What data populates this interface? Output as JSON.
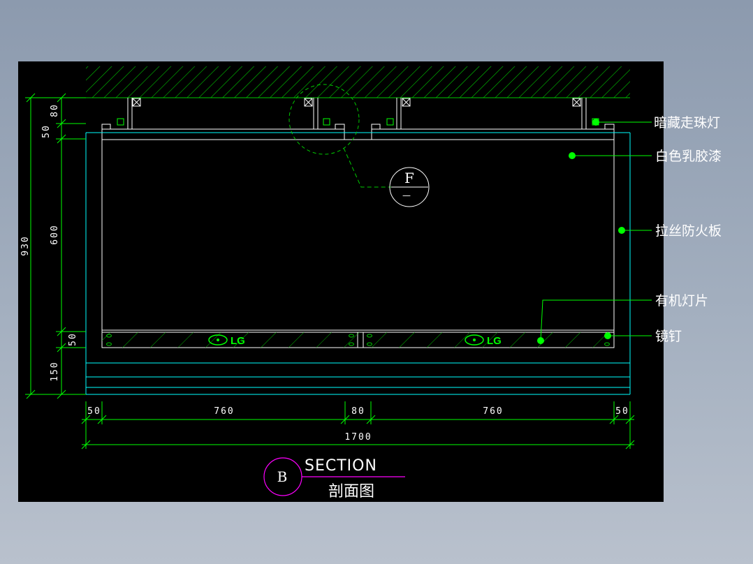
{
  "drawing": {
    "callouts": [
      "暗藏走珠灯",
      "白色乳胶漆",
      "拉丝防火板",
      "有机灯片",
      "镜钉"
    ],
    "vertical_dims": {
      "total": "930",
      "top_80": "80",
      "top_50": "50",
      "mid_600": "600",
      "low_50": "50",
      "bottom_150": "150"
    },
    "horizontal_dims": {
      "left_50": "50",
      "left_760": "760",
      "mid_80": "80",
      "right_760": "760",
      "right_50": "50",
      "total": "1700"
    },
    "detail_marker": {
      "letter": "F",
      "sub": "—"
    },
    "section": {
      "letter": "B",
      "label_en": "SECTION",
      "label_cn": "剖面图"
    },
    "logo_text": "LG",
    "colors": {
      "background": "#000000",
      "cyan": "#00ffff",
      "green": "#00ff00",
      "white": "#ffffff",
      "magenta": "#ff00ff",
      "hatch": "#00c800"
    }
  }
}
